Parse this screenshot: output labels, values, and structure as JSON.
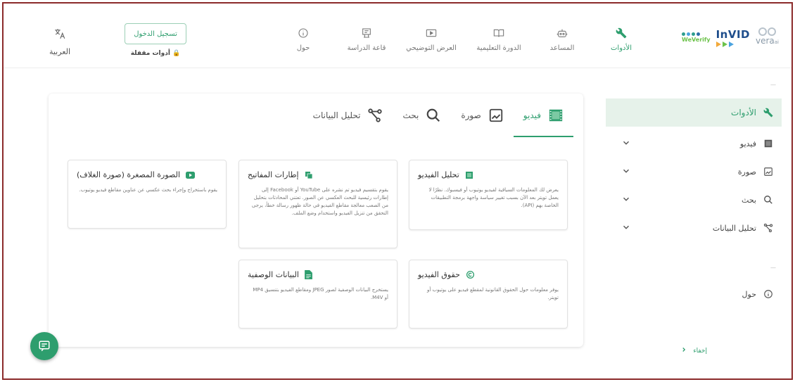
{
  "brand": {
    "vera": "vera",
    "vera_suffix": "ai",
    "invid": "InVID",
    "weverify": "WeVerify"
  },
  "nav": {
    "items": [
      {
        "label": "الأدوات",
        "icon": "wrench-icon"
      },
      {
        "label": "المساعد",
        "icon": "robot-icon"
      },
      {
        "label": "الدورة التعليمية",
        "icon": "book-icon"
      },
      {
        "label": "العرض التوضيحي",
        "icon": "slideshow-icon"
      },
      {
        "label": "قاعة الدراسة",
        "icon": "classroom-icon"
      },
      {
        "label": "حول",
        "icon": "info-icon"
      }
    ],
    "login_button": "تسجيل الدخول",
    "login_sub": "أدوات مقفلة",
    "language": "العربية"
  },
  "sidebar": {
    "tools_label": "الأدوات",
    "items": [
      {
        "label": "فيديو",
        "icon": "film-icon"
      },
      {
        "label": "صورة",
        "icon": "image-icon"
      },
      {
        "label": "بحث",
        "icon": "search-icon"
      },
      {
        "label": "تحليل البيانات",
        "icon": "data-analysis-icon"
      }
    ],
    "about_label": "حول",
    "collapse_label": "إخفاء"
  },
  "tabs": [
    {
      "label": "فيديو",
      "icon": "film-icon",
      "active": true
    },
    {
      "label": "صورة",
      "icon": "image-icon",
      "active": false
    },
    {
      "label": "بحث",
      "icon": "search-icon",
      "active": false
    },
    {
      "label": "تحليل البيانات",
      "icon": "data-analysis-icon",
      "active": false
    }
  ],
  "tools": [
    {
      "title": "تحليل الفيديو",
      "icon": "video-analysis-icon",
      "desc": "يعرض لك المعلومات السياقية لفيديو يوتيوب أو فيسبوك. نظرًا لا يعمل تويتر بعد الآن بسبب تغيير سياسة واجهة برمجة التطبيقات الخاصة بهم (API)."
    },
    {
      "title": "إطارات المفاتيح",
      "icon": "keyframes-icon",
      "desc": "يقوم بتقسيم فيديو تم نشره على YouTube أو Facebook إلى إطارات رئيسية للبحث العكسي عن الصور. تعتني المحادثات بتحليل من الصعب معالجة مقاطع الفيديو في حالة ظهور رسالة خطأ، يرجى التحقق من تنزيل الفيديو واستخدام وضع الملف."
    },
    {
      "title": "الصورة المصغرة (صورة الغلاف)",
      "icon": "youtube-icon",
      "desc": "يقوم باستخراج وإجراء بحث عكسي عن عناوين مقاطع فيديو يوتيوب."
    },
    {
      "title": "حقوق الفيديو",
      "icon": "copyright-icon",
      "desc": "يوفر معلومات حول الحقوق القانونية لمقطع فيديو على يوتيوب أو تويتر."
    },
    {
      "title": "البيانات الوصفية",
      "icon": "metadata-icon",
      "desc": "يستخرج البيانات الوصفية لصور JPEG ومقاطع الفيديو بتنسيق MP4 أو M4V."
    }
  ],
  "colors": {
    "accent": "#2e9e6e",
    "frame": "#8b2b2b",
    "active_bg": "#e6f2ea"
  }
}
